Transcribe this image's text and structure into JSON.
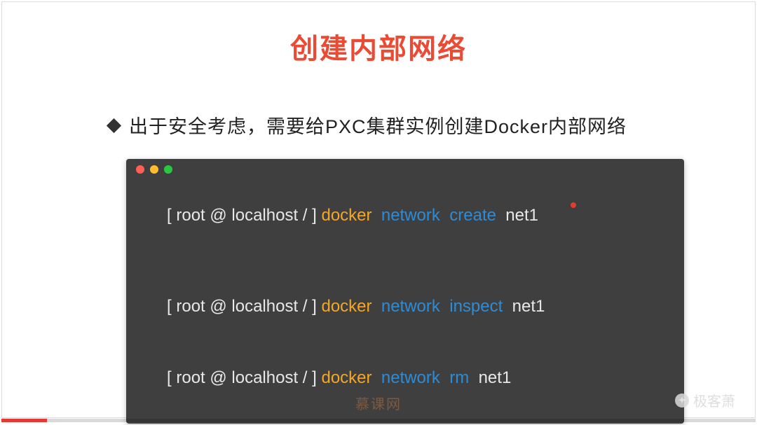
{
  "colors": {
    "title": "#e94b35",
    "cmd": "#f5a623",
    "sub": "#2e8cd6",
    "terminal_bg": "#3f3f3f",
    "progress": "#e53935"
  },
  "title": "创建内部网络",
  "bullet": "出于安全考虑，需要给PXC集群实例创建Docker内部网络",
  "prompt": "[ root @ localhost / ] ",
  "lines": [
    {
      "cmd": "docker",
      "sub1": "network",
      "sub2": "create",
      "arg": "net1"
    },
    {
      "cmd": "docker",
      "sub1": "network",
      "sub2": "inspect",
      "arg": "net1"
    },
    {
      "cmd": "docker",
      "sub1": "network",
      "sub2": "rm",
      "arg": "net1"
    }
  ],
  "watermark_right": "极客萧",
  "watermark_center": "慕课网",
  "progress_percent": 6
}
